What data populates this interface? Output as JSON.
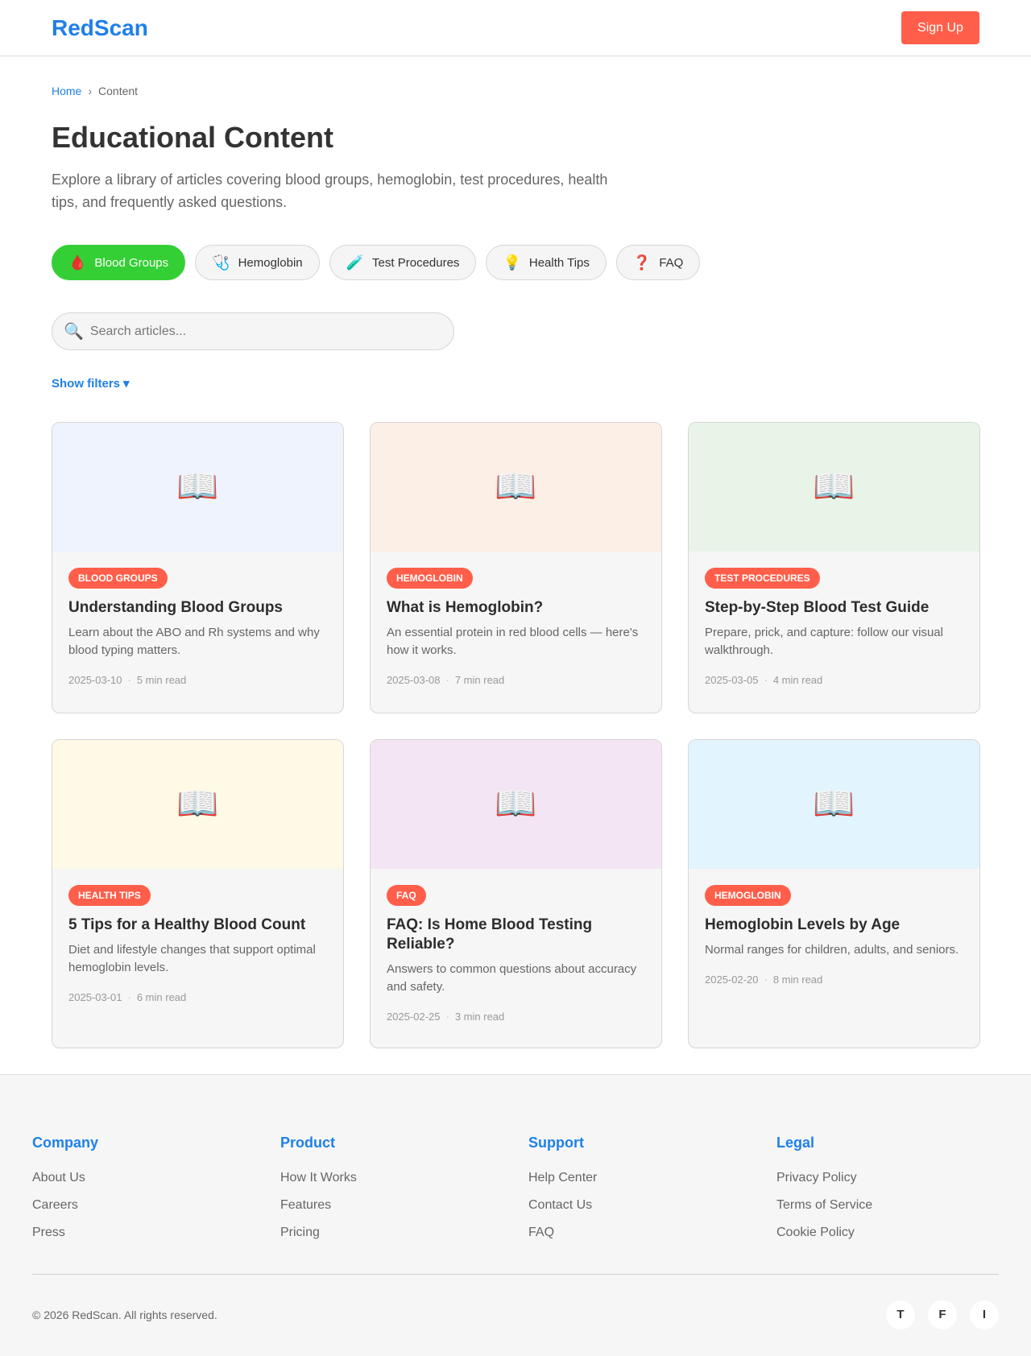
{
  "header": {
    "logo": "RedScan",
    "signup_label": "Sign Up"
  },
  "breadcrumb": {
    "home": "Home",
    "separator": "›",
    "current": "Content"
  },
  "page": {
    "title": "Educational Content",
    "description": "Explore a library of articles covering blood groups, hemoglobin, test procedures, health tips, and frequently asked questions."
  },
  "categories": [
    {
      "label": "Blood Groups",
      "icon": "🩸",
      "icon_name": "blood-drop-icon",
      "active": true
    },
    {
      "label": "Hemoglobin",
      "icon": "🩺",
      "icon_name": "stethoscope-icon",
      "active": false
    },
    {
      "label": "Test Procedures",
      "icon": "🧪",
      "icon_name": "test-tube-icon",
      "active": false
    },
    {
      "label": "Health Tips",
      "icon": "💡",
      "icon_name": "lightbulb-icon",
      "active": false
    },
    {
      "label": "FAQ",
      "icon": "❓",
      "icon_name": "question-mark-icon",
      "active": false
    }
  ],
  "search": {
    "icon": "🔍",
    "placeholder": "Search articles...",
    "value": ""
  },
  "filters": {
    "label": "Show filters",
    "chevron": "▾"
  },
  "articles": [
    {
      "tag": "Blood Groups",
      "title": "Understanding Blood Groups",
      "desc": "Learn about the ABO and Rh systems and why blood typing matters.",
      "date": "2025-03-10",
      "read": "5 min read",
      "image_bg": "#eef3fd",
      "image_icon": "📖"
    },
    {
      "tag": "Hemoglobin",
      "title": "What is Hemoglobin?",
      "desc": "An essential protein in red blood cells — here's how it works.",
      "date": "2025-03-08",
      "read": "7 min read",
      "image_bg": "#fcefe6",
      "image_icon": "📖"
    },
    {
      "tag": "Test Procedures",
      "title": "Step-by-Step Blood Test Guide",
      "desc": "Prepare, prick, and capture: follow our visual walkthrough.",
      "date": "2025-03-05",
      "read": "4 min read",
      "image_bg": "#e8f4e8",
      "image_icon": "📖"
    },
    {
      "tag": "Health Tips",
      "title": "5 Tips for a Healthy Blood Count",
      "desc": "Diet and lifestyle changes that support optimal hemoglobin levels.",
      "date": "2025-03-01",
      "read": "6 min read",
      "image_bg": "#fefae6",
      "image_icon": "📖"
    },
    {
      "tag": "FAQ",
      "title": "FAQ: Is Home Blood Testing Reliable?",
      "desc": "Answers to common questions about accuracy and safety.",
      "date": "2025-02-25",
      "read": "3 min read",
      "image_bg": "#f3e5f4",
      "image_icon": "📖"
    },
    {
      "tag": "Hemoglobin",
      "title": "Hemoglobin Levels by Age",
      "desc": "Normal ranges for children, adults, and seniors.",
      "date": "2025-02-20",
      "read": "8 min read",
      "image_bg": "#e2f4fd",
      "image_icon": "📖"
    }
  ],
  "footer": {
    "columns": [
      {
        "heading": "Company",
        "links": [
          "About Us",
          "Careers",
          "Press"
        ]
      },
      {
        "heading": "Product",
        "links": [
          "How It Works",
          "Features",
          "Pricing"
        ]
      },
      {
        "heading": "Support",
        "links": [
          "Help Center",
          "Contact Us",
          "FAQ"
        ]
      },
      {
        "heading": "Legal",
        "links": [
          "Privacy Policy",
          "Terms of Service",
          "Cookie Policy"
        ]
      }
    ],
    "copyright": "© 2026 RedScan. All rights reserved.",
    "socials": [
      {
        "label": "T",
        "name": "twitter"
      },
      {
        "label": "F",
        "name": "facebook"
      },
      {
        "label": "I",
        "name": "instagram"
      }
    ]
  },
  "colors": {
    "brand_blue": "#1f80e8",
    "accent_red": "#ff5f4a",
    "active_green": "#34cf34"
  }
}
